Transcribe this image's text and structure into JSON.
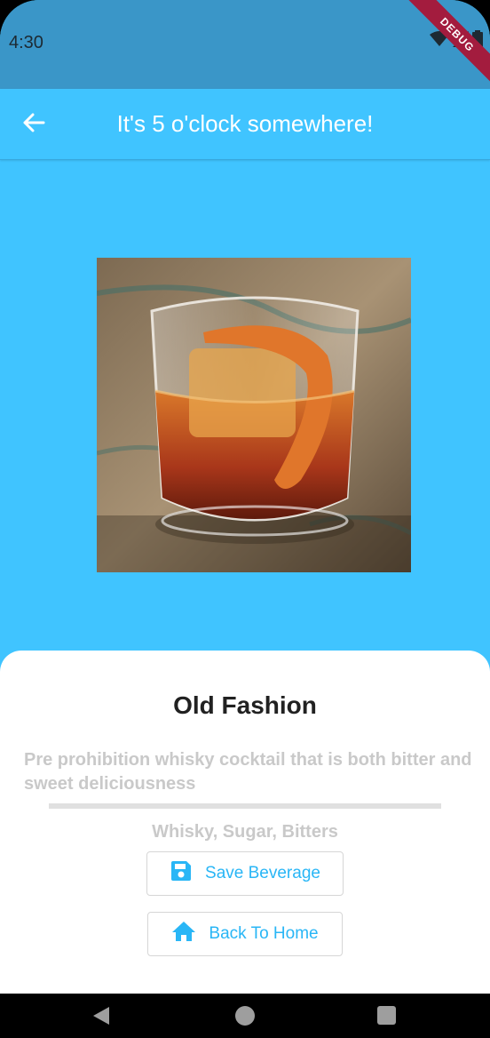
{
  "status_bar": {
    "time": "4:30",
    "debug_label": "DEBUG",
    "icons": [
      "wifi-icon",
      "signal-icon",
      "battery-icon"
    ]
  },
  "app_bar": {
    "title": "It's 5 o'clock somewhere!",
    "back_icon": "arrow-back-icon"
  },
  "beverage": {
    "image": "old-fashioned-cocktail-photo",
    "name": "Old Fashion",
    "description": "Pre prohibition whisky cocktail that is both bitter and sweet deliciousness",
    "ingredients": "Whisky, Sugar, Bitters"
  },
  "actions": {
    "save_label": "Save Beverage",
    "save_icon": "save-icon",
    "home_label": "Back To Home",
    "home_icon": "home-icon"
  },
  "nav_bar": {
    "icons": [
      "nav-back-icon",
      "nav-home-icon",
      "nav-recents-icon"
    ]
  },
  "colors": {
    "primary": "#40C4FF",
    "status_bar": "#3A96C8",
    "accent_text": "#29B6F6",
    "muted_text": "#C9C9C9",
    "debug_banner": "#A31C3E"
  }
}
